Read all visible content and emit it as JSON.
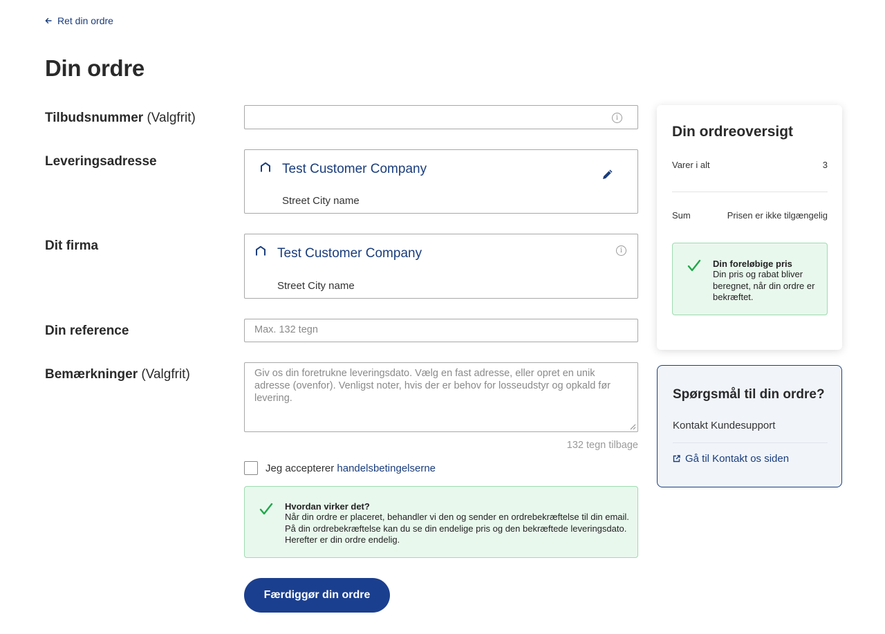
{
  "nav": {
    "back_label": "Ret din ordre",
    "back_icon": "arrow-left-icon"
  },
  "page": {
    "title": "Din ordre"
  },
  "form": {
    "offer_number": {
      "label": "Tilbudsnummer",
      "optional": "(Valgfrit)",
      "value": ""
    },
    "delivery_address": {
      "label": "Leveringsadresse",
      "company": "Test Customer Company",
      "street": "Street City name"
    },
    "company": {
      "label": "Dit firma",
      "company": "Test Customer Company",
      "street": "Street City name"
    },
    "reference": {
      "label": "Din reference",
      "placeholder": "Max. 132 tegn",
      "value": ""
    },
    "remarks": {
      "label": "Bemærkninger",
      "optional": "(Valgfrit)",
      "placeholder": "Giv os din foretrukne leveringsdato. Vælg en fast adresse, eller opret en unik adresse (ovenfor). Venligst noter, hvis der er behov for losseudstyr og opkald før levering.",
      "counter": "132 tegn tilbage"
    },
    "terms": {
      "prefix": "Jeg accepterer",
      "link": "handelsbetingelserne",
      "checked": false
    },
    "how_it_works": {
      "title": "Hvordan virker det?",
      "lines": [
        "Når din ordre er placeret, behandler vi den og sender en ordrebekræftelse til din email.",
        "På din ordrebekræftelse kan du se din endelige pris og den bekræftede leveringsdato.",
        "Herefter er din ordre endelig."
      ]
    },
    "submit_label": "Færdiggør din ordre"
  },
  "summary": {
    "title": "Din ordreoversigt",
    "items_label": "Varer i alt",
    "items_count": "3",
    "sum_label": "Sum",
    "sum_value": "Prisen er ikke tilgængelig",
    "notice": {
      "title": "Din foreløbige pris",
      "lines": [
        "Din pris og rabat bliver",
        "beregnet, når din ordre er",
        "bekræftet."
      ]
    }
  },
  "support": {
    "title": "Spørgsmål til din ordre?",
    "contact": "Kontakt Kundesupport",
    "link": "Gå til Kontakt os siden"
  },
  "colors": {
    "primary": "#1b3f8f",
    "link": "#1a3d7c",
    "success_bg": "#e9f8ed",
    "success_border": "#9ddbb0",
    "check": "#1fa84a"
  }
}
